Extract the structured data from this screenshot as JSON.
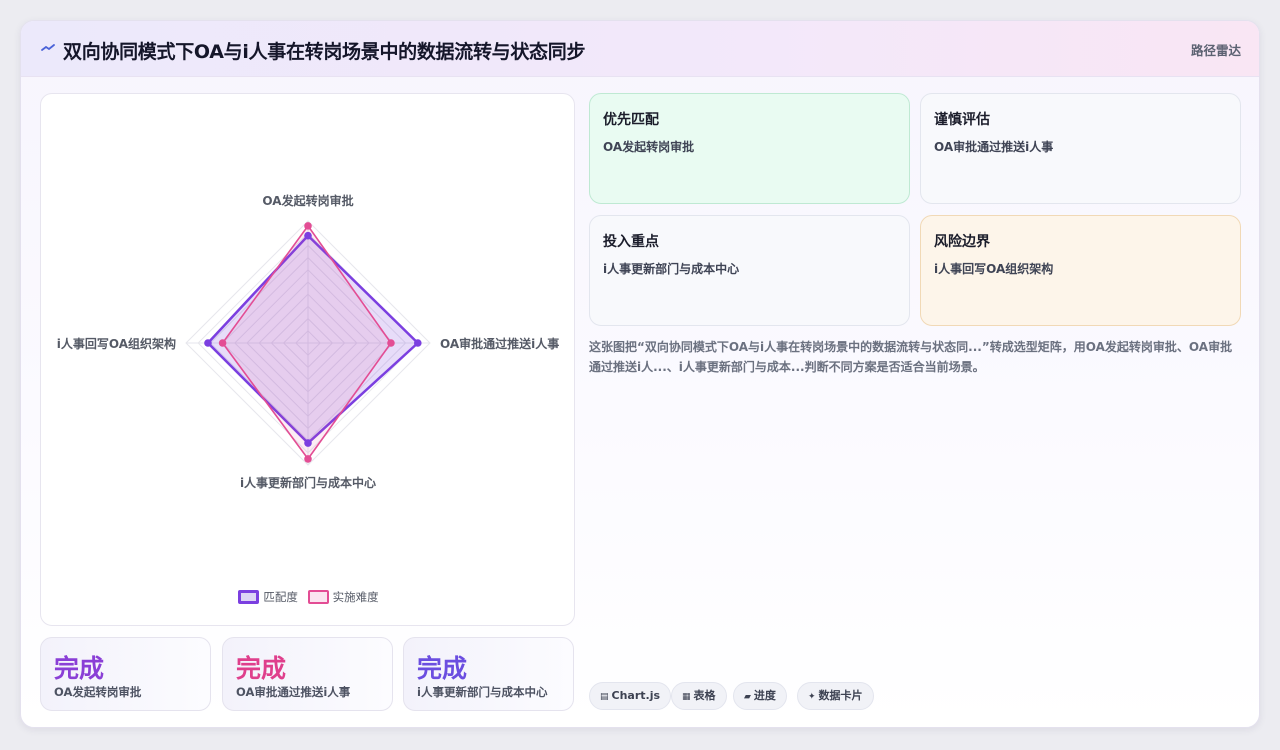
{
  "header": {
    "title": "双向协同模式下OA与i人事在转岗场景中的数据流转与状态同步",
    "tag": "路径雷达"
  },
  "colors": {
    "series_a": "#7b3fe0",
    "series_b": "#e34d94",
    "priority_tile_bg": "#e9fbf2",
    "risk_tile_bg": "#fdf5ea"
  },
  "chart_data": {
    "type": "radar",
    "categories": [
      "OA发起转岗审批",
      "OA审批通过推送i人事",
      "i人事更新部门与成本中心",
      "i人事回写OA组织架构"
    ],
    "series": [
      {
        "name": "匹配度",
        "values": [
          88,
          90,
          82,
          82
        ],
        "color": "#7b3fe0"
      },
      {
        "name": "实施难度",
        "values": [
          96,
          68,
          95,
          70
        ],
        "color": "#e34d94"
      }
    ],
    "rlim": [
      0,
      100
    ],
    "grid": true,
    "legend": "bottom"
  },
  "stats": [
    {
      "value": "完成",
      "label": "OA发起转岗审批",
      "color": "#8a3fd6"
    },
    {
      "value": "完成",
      "label": "OA审批通过推送i人事",
      "color": "#df3f8c"
    },
    {
      "value": "完成",
      "label": "i人事更新部门与成本中心",
      "color": "#6b4ee0"
    }
  ],
  "tiles": [
    {
      "title": "优先匹配",
      "sub": "OA发起转岗审批"
    },
    {
      "title": "谨慎评估",
      "sub": "OA审批通过推送i人事"
    },
    {
      "title": "投入重点",
      "sub": "i人事更新部门与成本中心"
    },
    {
      "title": "风险边界",
      "sub": "i人事回写OA组织架构"
    }
  ],
  "description": "这张图把“双向协同模式下OA与i人事在转岗场景中的数据流转与状态同...”转成选型矩阵，用OA发起转岗审批、OA审批通过推送i人...、i人事更新部门与成本...判断不同方案是否适合当前场景。",
  "chips": [
    {
      "icon": "▤",
      "label": "Chart.js"
    },
    {
      "icon": "▦",
      "label": "表格"
    },
    {
      "icon": "▰",
      "label": "进度"
    },
    {
      "icon": "✦",
      "label": "数据卡片"
    }
  ]
}
